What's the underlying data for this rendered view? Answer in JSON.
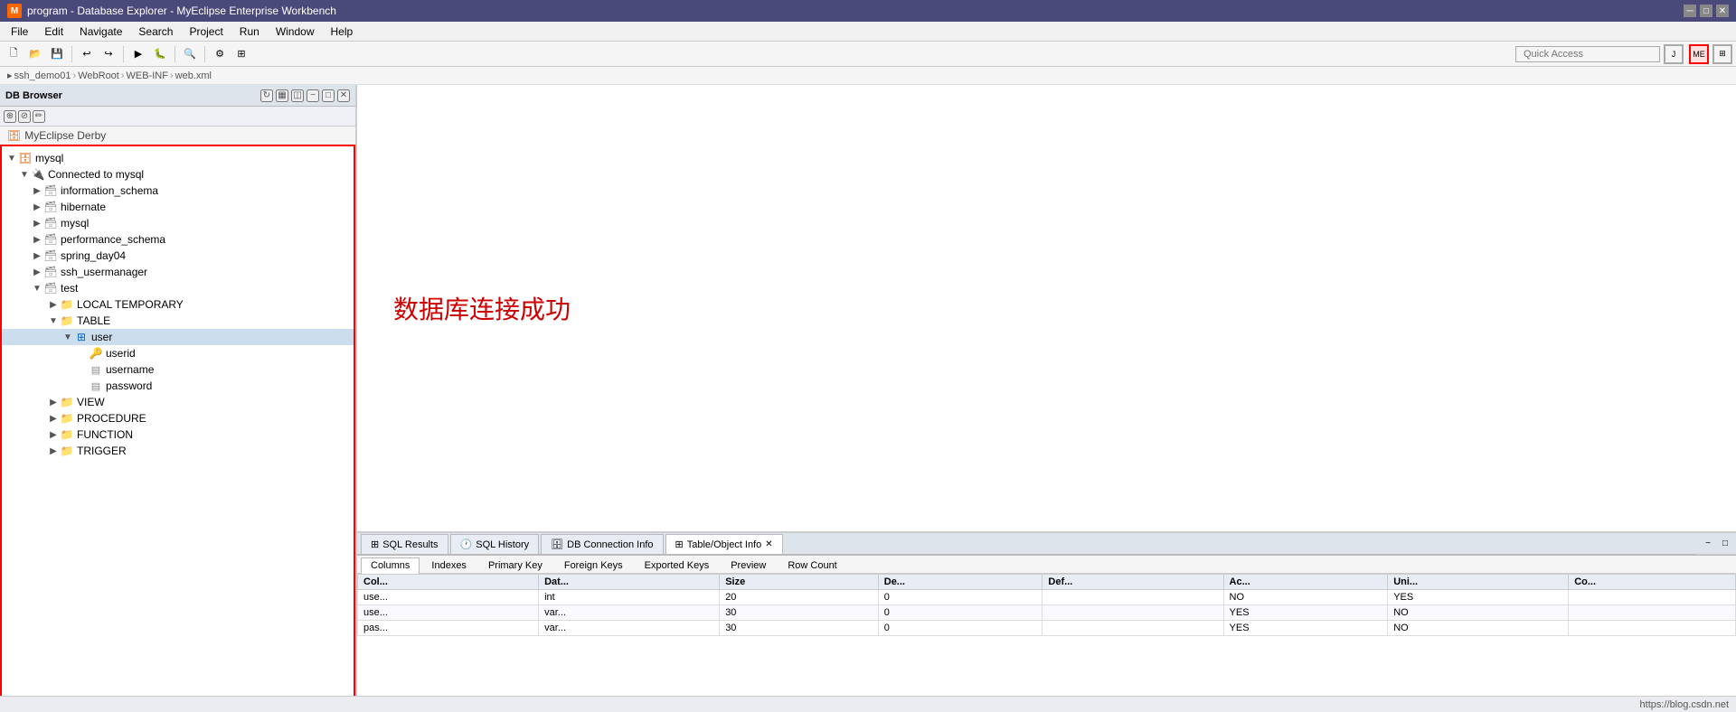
{
  "window": {
    "title": "program - Database Explorer - MyEclipse Enterprise Workbench",
    "icon": "ME"
  },
  "menubar": {
    "items": [
      "File",
      "Edit",
      "Navigate",
      "Search",
      "Project",
      "Run",
      "Window",
      "Help"
    ]
  },
  "toolbar": {
    "quick_access_placeholder": "Quick Access"
  },
  "breadcrumb": {
    "parts": [
      "ssh_demo01",
      "WebRoot",
      "WEB-INF",
      "web.xml"
    ]
  },
  "left_panel": {
    "title": "DB Browser",
    "derby": {
      "label": "MyEclipse Derby"
    },
    "tree": {
      "root": "mysql",
      "connected_label": "Connected to mysql",
      "schemas": [
        {
          "name": "information_schema",
          "expanded": false
        },
        {
          "name": "hibernate",
          "expanded": false
        },
        {
          "name": "mysql",
          "expanded": false
        },
        {
          "name": "performance_schema",
          "expanded": false
        },
        {
          "name": "spring_day04",
          "expanded": false
        },
        {
          "name": "ssh_usermanager",
          "expanded": false
        },
        {
          "name": "test",
          "expanded": true,
          "children": [
            {
              "type": "folder",
              "name": "LOCAL TEMPORARY",
              "expanded": false
            },
            {
              "type": "folder",
              "name": "TABLE",
              "expanded": true,
              "children": [
                {
                  "type": "table",
                  "name": "user",
                  "expanded": true,
                  "selected": true,
                  "columns": [
                    {
                      "name": "userid",
                      "type": "pk"
                    },
                    {
                      "name": "username",
                      "type": "col"
                    },
                    {
                      "name": "password",
                      "type": "col"
                    }
                  ]
                }
              ]
            },
            {
              "type": "folder",
              "name": "VIEW",
              "expanded": false
            },
            {
              "type": "folder",
              "name": "PROCEDURE",
              "expanded": false
            },
            {
              "type": "folder",
              "name": "FUNCTION",
              "expanded": false
            },
            {
              "type": "folder",
              "name": "TRIGGER",
              "expanded": false
            }
          ]
        }
      ]
    }
  },
  "editor": {
    "success_message": "数据库连接成功"
  },
  "bottom_panel": {
    "tabs": [
      {
        "label": "SQL Results",
        "icon": "table"
      },
      {
        "label": "SQL History",
        "icon": "history"
      },
      {
        "label": "DB Connection Info",
        "icon": "db"
      },
      {
        "label": "Table/Object Info",
        "icon": "info",
        "active": true,
        "closable": true
      }
    ],
    "sub_tabs": [
      "Columns",
      "Indexes",
      "Primary Key",
      "Foreign Keys",
      "Exported Keys",
      "Preview",
      "Row Count"
    ],
    "active_sub_tab": "Columns",
    "columns_header": [
      "Col...",
      "Dat...",
      "Size",
      "De...",
      "Def...",
      "Ac...",
      "Uni...",
      "Co..."
    ],
    "rows": [
      {
        "col": "use...",
        "dat": "int",
        "size": "20",
        "de": "0",
        "def": "",
        "ac": "NO",
        "uni": "YES",
        "co": ""
      },
      {
        "col": "use...",
        "dat": "var...",
        "size": "30",
        "de": "0",
        "def": "",
        "ac": "YES",
        "uni": "NO",
        "co": ""
      },
      {
        "col": "pas...",
        "dat": "var...",
        "size": "30",
        "de": "0",
        "def": "",
        "ac": "YES",
        "uni": "NO",
        "co": ""
      }
    ]
  },
  "status_bar": {
    "url": "https://blog.csdn.net"
  }
}
